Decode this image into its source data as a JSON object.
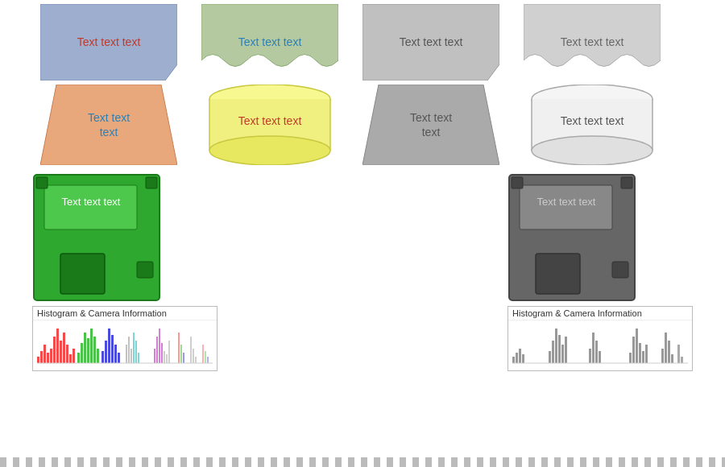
{
  "shapes": {
    "row1": [
      {
        "id": "bookmark-blue",
        "text": "Text text text",
        "fill": "#9daecf",
        "stroke": "#7a90b5",
        "textColor": "#c0392b",
        "type": "bookmark"
      },
      {
        "id": "wavy-green",
        "text": "Text text text",
        "fill": "#b5c9a0",
        "stroke": "#8aaa72",
        "textColor": "#2980b9",
        "type": "wavy"
      },
      {
        "id": "bookmark-gray",
        "text": "Text text text",
        "fill": "#c0c0c0",
        "stroke": "#999",
        "textColor": "#555",
        "type": "bookmark"
      },
      {
        "id": "wavy-gray",
        "text": "Text text text",
        "fill": "#d0d0d0",
        "stroke": "#aaa",
        "textColor": "#666",
        "type": "wavy"
      }
    ],
    "row2": [
      {
        "id": "trapezoid-orange",
        "text": "Text text\ntext",
        "fill": "#e8a87c",
        "stroke": "#c77d50",
        "textColor": "#2980b9",
        "type": "trapezoid"
      },
      {
        "id": "cylinder-yellow",
        "text": "Text text text",
        "fill": "#f0f080",
        "stroke": "#c8c840",
        "textColor": "#c0392b",
        "type": "cylinder"
      },
      {
        "id": "trapezoid-gray",
        "text": "Text text\ntext",
        "fill": "#aaaaaa",
        "stroke": "#888",
        "textColor": "#555",
        "type": "trapezoid"
      },
      {
        "id": "cylinder-white",
        "text": "Text text text",
        "fill": "#f0f0f0",
        "stroke": "#aaa",
        "textColor": "#555",
        "type": "cylinder"
      }
    ],
    "row3": [
      {
        "id": "floppy-green",
        "text": "Text text text",
        "fill": "#2ea82e",
        "stroke": "#1a7a1a",
        "labelColor": "#fff",
        "type": "floppy"
      },
      {
        "id": "floppy-gray",
        "text": "Text text text",
        "fill": "#666",
        "stroke": "#444",
        "labelColor": "#ccc",
        "type": "floppy"
      }
    ]
  },
  "histograms": [
    {
      "id": "histogram-color",
      "title": "Histogram & Camera Information",
      "hasColor": true
    },
    {
      "id": "histogram-gray",
      "title": "Histogram & Camera Information",
      "hasColor": false
    }
  ]
}
